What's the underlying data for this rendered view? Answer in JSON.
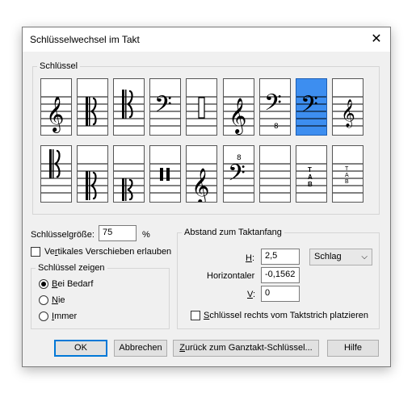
{
  "window": {
    "title": "Schlüsselwechsel im Takt",
    "close_glyph": "✕"
  },
  "clef_group": {
    "legend": "Schlüssel"
  },
  "clef_tiles": {
    "row1": [
      {
        "name": "treble-clef"
      },
      {
        "name": "alto-clef"
      },
      {
        "name": "tenor-clef"
      },
      {
        "name": "bass-clef"
      },
      {
        "name": "percussion-rect-clef"
      },
      {
        "name": "treble-8va-clef"
      },
      {
        "name": "bass-8vb-clef"
      },
      {
        "name": "bass-clef-selected",
        "selected": true
      },
      {
        "name": "treble-small-clef"
      }
    ],
    "row2": [
      {
        "name": "c-clef-top"
      },
      {
        "name": "c-clef-low"
      },
      {
        "name": "c-clef-lowest"
      },
      {
        "name": "percussion-bars-clef"
      },
      {
        "name": "french-violin-clef"
      },
      {
        "name": "bass-8va-clef"
      },
      {
        "name": "blank-clef"
      },
      {
        "name": "tab-clef"
      },
      {
        "name": "tab-small-clef"
      }
    ],
    "selected_color": "#3d8ef0"
  },
  "size": {
    "label": "Schlüsselgröße:",
    "value": "75",
    "unit": "%"
  },
  "vertical": {
    "pre": "Ve",
    "u": "r",
    "post": "tikales Verschieben erlauben"
  },
  "show_group": {
    "legend": "Schlüssel zeigen",
    "options": [
      {
        "u": "B",
        "rest": "ei Bedarf",
        "checked": true
      },
      {
        "u": "N",
        "rest": "ie",
        "checked": false
      },
      {
        "u": "I",
        "rest": "mmer",
        "checked": false
      }
    ]
  },
  "distance_group": {
    "legend": "Abstand zum Taktanfang",
    "h_label_u": "H",
    "h_label_rest": ":",
    "h_value": "2,5",
    "unit_select": "Schlag",
    "horiz_label": "Horizontaler",
    "horiz_value": "-0,1562",
    "v_label_u": "V",
    "v_label_rest": ":",
    "v_value": "0",
    "right_clef": {
      "u": "S",
      "rest": "chlüssel rechts vom Taktstrich platzieren"
    }
  },
  "buttons": {
    "ok": "OK",
    "cancel": "Abbrechen",
    "reset": {
      "u": "Z",
      "rest": "urück zum Ganztakt-Schlüssel..."
    },
    "help": "Hilfe"
  }
}
